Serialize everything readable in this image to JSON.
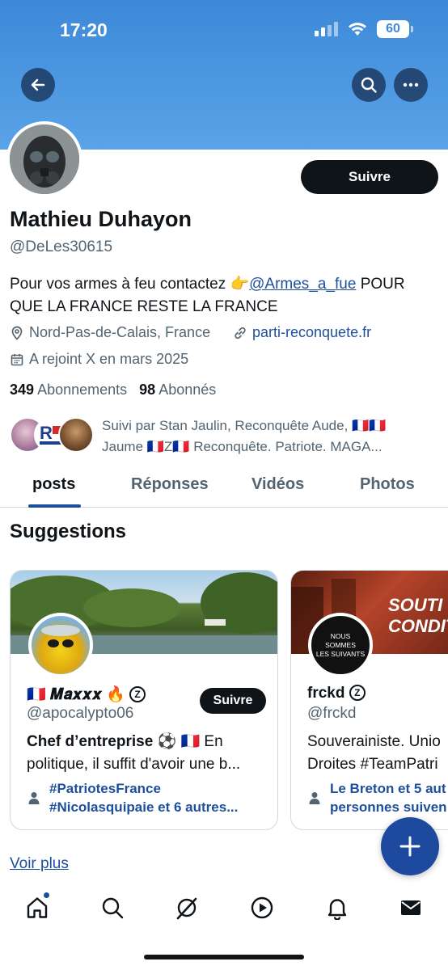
{
  "status_bar": {
    "time": "17:20",
    "battery": "60"
  },
  "profile": {
    "follow_label": "Suivre",
    "name": "Mathieu Duhayon",
    "handle": "@DeLes30615",
    "bio_prefix": "Pour vos armes à feu contactez 👉",
    "bio_mention": "@Armes_a_fue",
    "bio_suffix": " POUR QUE LA FRANCE RESTE LA FRANCE",
    "location": "Nord-Pas-de-Calais, France",
    "website": "parti-reconquete.fr",
    "joined": "A rejoint X en mars 2025",
    "following_count": "349",
    "following_label": "Abonnements",
    "followers_count": "98",
    "followers_label": "Abonnés",
    "followed_by_line1": "Suivi par Stan Jaulin, Reconquête Aude, 🇫🇷🇫🇷",
    "followed_by_line2": "Jaume 🇫🇷Z🇫🇷 Reconquête. Patriote. MAGA..."
  },
  "tabs": [
    {
      "label": "posts",
      "active": true
    },
    {
      "label": "Réponses",
      "active": false
    },
    {
      "label": "Vidéos",
      "active": false
    },
    {
      "label": "Photos",
      "active": false
    }
  ],
  "suggestions": {
    "title": "Suggestions",
    "cards": [
      {
        "name": "🇫🇷 𝑴𝒂𝒙𝒙𝒙 🔥",
        "verified_badge": "Z",
        "handle": "@apocalypto06",
        "follow_label": "Suivre",
        "bio_bold": "Chef d’entreprise ⚽️ 🇫🇷",
        "bio_rest": " En",
        "bio_line2": "politique, il suffit d'avoir une b...",
        "foot_line1": "#PatriotesFrance",
        "foot_line2": "#Nicolasquipaie et 6 autres..."
      },
      {
        "name": "frckd",
        "verified_badge": "Z",
        "handle": "@frckd",
        "avatar_text_1": "NOUS",
        "avatar_text_2": "SOMMES",
        "avatar_text_3": "LES SUIVANTS",
        "banner_text_1": "SOUTI",
        "banner_text_2": "CONDITI",
        "bio_line1": "Souverainiste. Unio",
        "bio_line2": "Droites #TeamPatri",
        "foot_line1": "Le Breton et 5 aut",
        "foot_line2": "personnes suiven"
      }
    ],
    "see_more": "Voir plus"
  },
  "colors": {
    "accent": "#1d4f9c",
    "banner": "#4a96e0",
    "text": "#0f1419",
    "muted": "#536471"
  }
}
